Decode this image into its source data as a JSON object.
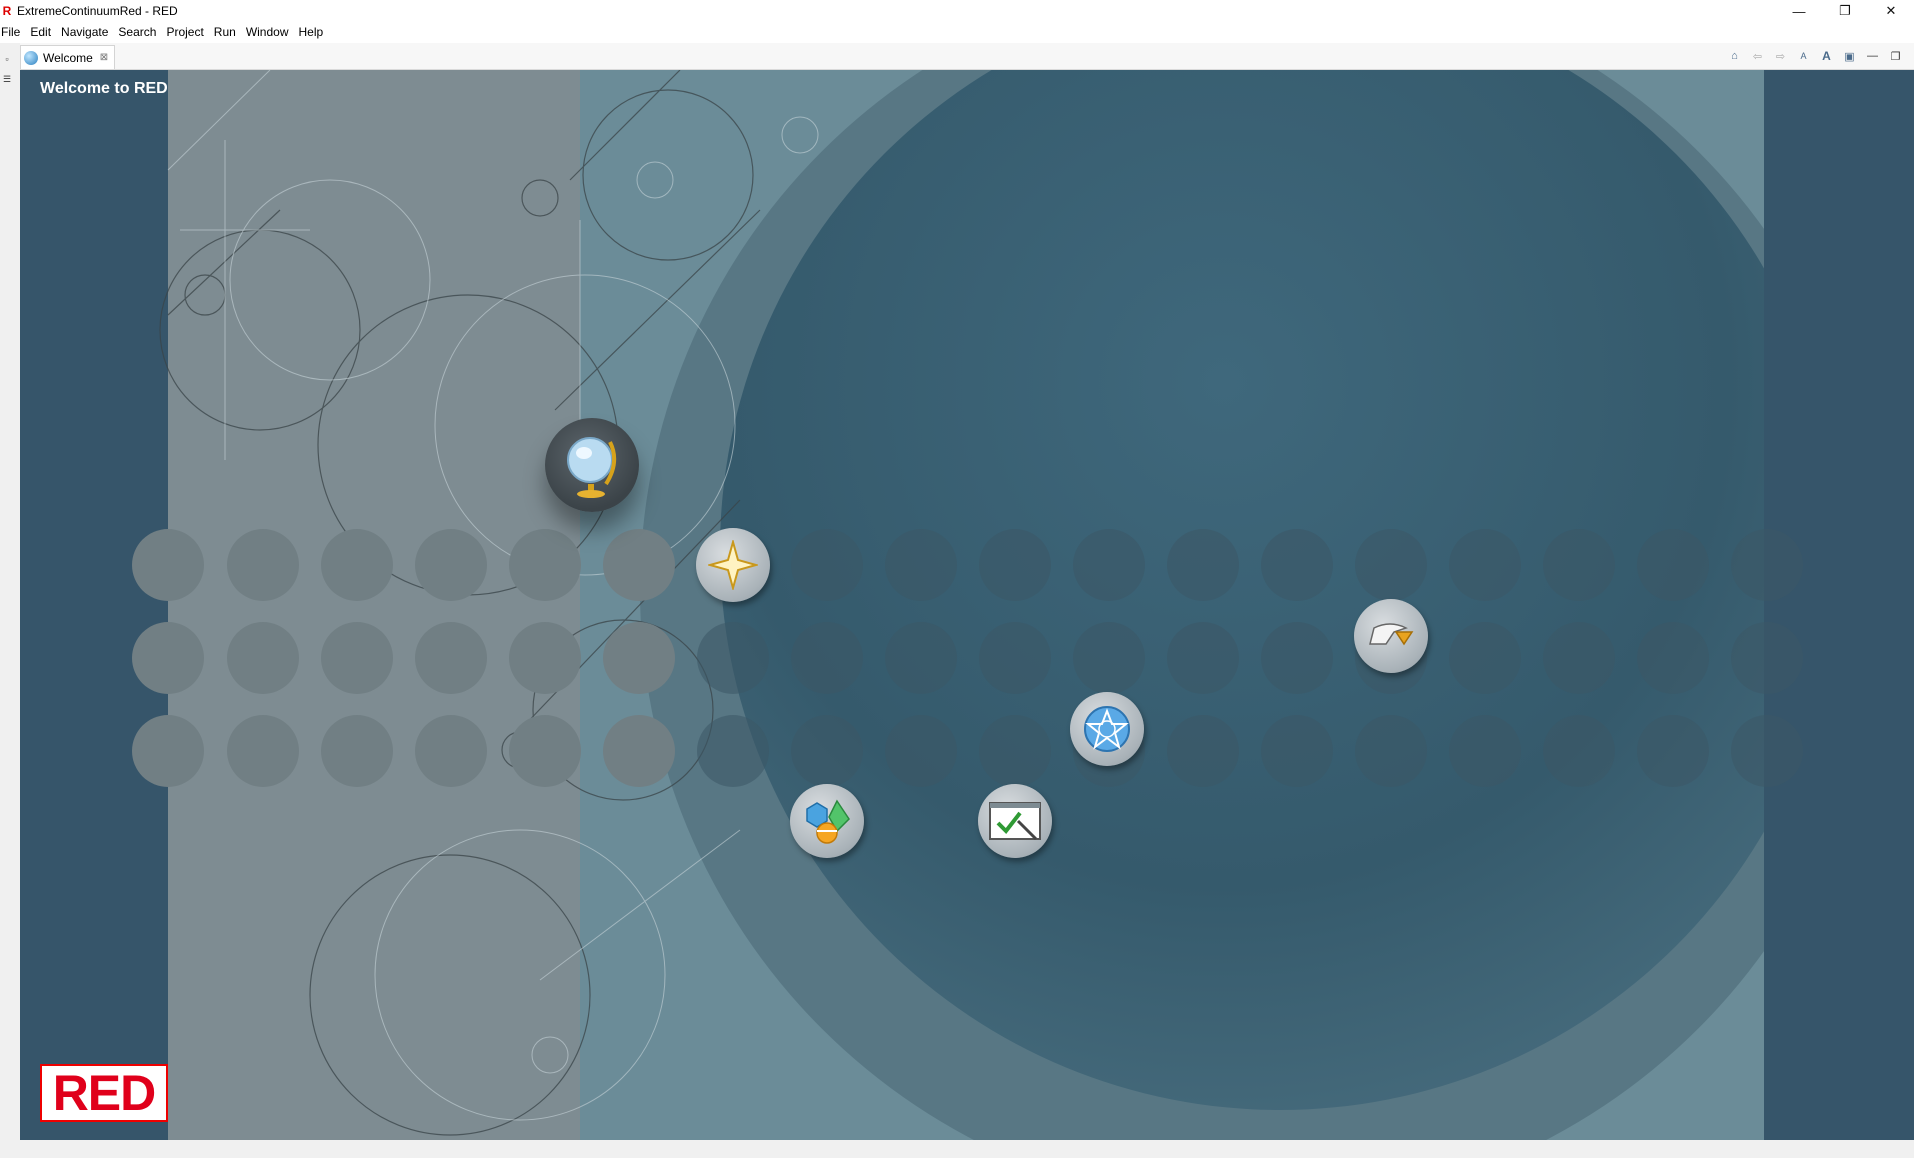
{
  "window": {
    "title": "ExtremeContinuumRed - RED",
    "app_icon_glyph": "R",
    "controls": {
      "minimize": "—",
      "restore": "❐",
      "close": "✕"
    }
  },
  "menu": {
    "items": [
      "File",
      "Edit",
      "Navigate",
      "Search",
      "Project",
      "Run",
      "Window",
      "Help"
    ]
  },
  "editor": {
    "tab": {
      "label": "Welcome",
      "icon": "globe-icon",
      "close_glyph": "⊠"
    },
    "toolbar": [
      {
        "name": "home-icon",
        "glyph": "⌂"
      },
      {
        "name": "back-icon",
        "glyph": "⇦"
      },
      {
        "name": "forward-icon",
        "glyph": "⇨"
      },
      {
        "name": "reduce-font-icon",
        "glyph": "A"
      },
      {
        "name": "increase-font-icon",
        "glyph": "A"
      },
      {
        "name": "customize-icon",
        "glyph": "▣"
      },
      {
        "name": "minimize-view-icon",
        "glyph": "—"
      },
      {
        "name": "maximize-view-icon",
        "glyph": "❐"
      }
    ]
  },
  "welcome": {
    "title": "Welcome to RED",
    "logo_text": "RED",
    "colors": {
      "background": "#36556a",
      "logo_red": "#e0001b"
    },
    "icons": [
      {
        "name": "overview-icon",
        "glyph": "🌐"
      },
      {
        "name": "whats-new-icon",
        "glyph": "✦"
      },
      {
        "name": "samples-icon",
        "glyph": "◆"
      },
      {
        "name": "tutorials-icon",
        "glyph": "✔"
      },
      {
        "name": "web-resources-icon",
        "glyph": "✪"
      },
      {
        "name": "workbench-icon",
        "glyph": "➦"
      }
    ]
  }
}
